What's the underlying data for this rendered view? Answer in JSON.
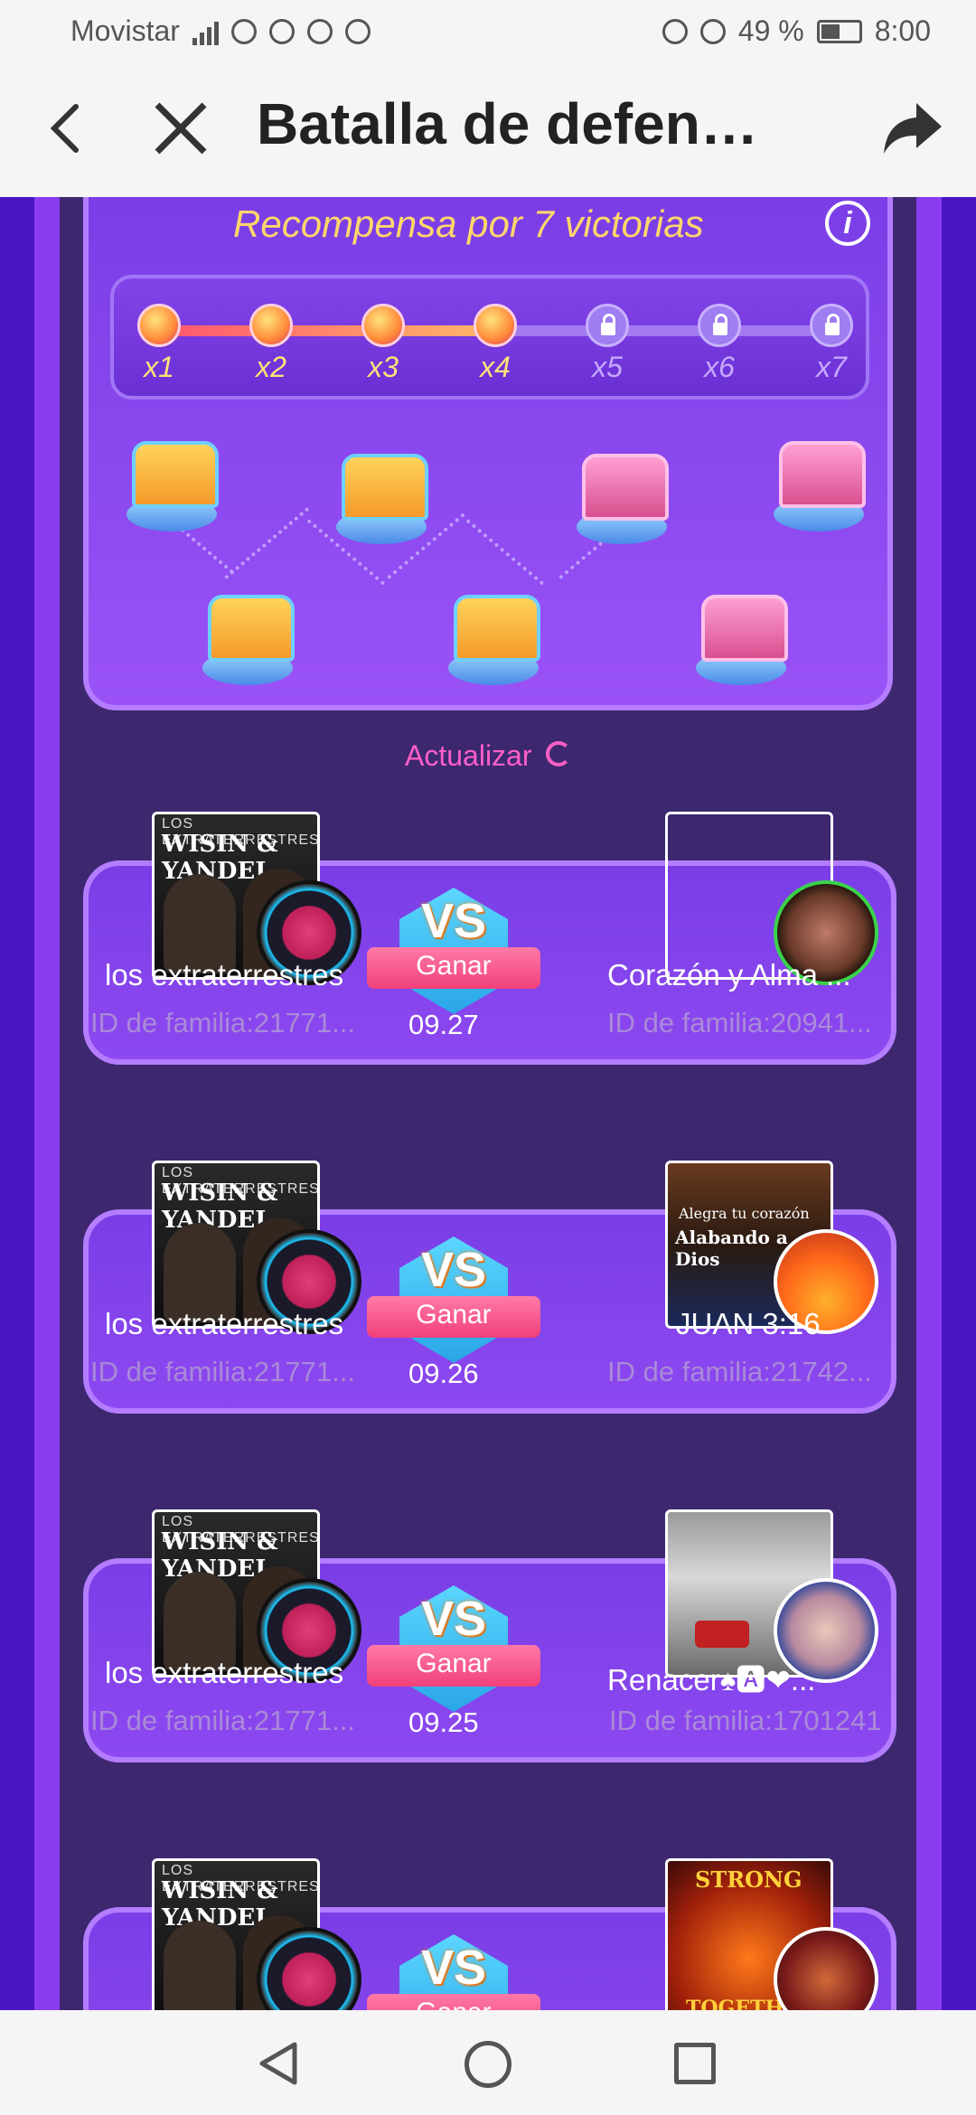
{
  "status_bar": {
    "carrier": "Movistar",
    "battery": "49 %",
    "time": "8:00"
  },
  "header": {
    "title": "Batalla de defen…"
  },
  "rewards": {
    "title": "Recompensa por 7 victorias",
    "info_icon": "i",
    "progress_fraction": 0.5,
    "steps": [
      {
        "label": "x1",
        "state": "done"
      },
      {
        "label": "x2",
        "state": "done"
      },
      {
        "label": "x3",
        "state": "done"
      },
      {
        "label": "x4",
        "state": "done"
      },
      {
        "label": "x5",
        "state": "locked"
      },
      {
        "label": "x6",
        "state": "locked"
      },
      {
        "label": "x7",
        "state": "locked"
      }
    ]
  },
  "update": {
    "label": "Actualizar"
  },
  "battles": [
    {
      "left_name": "los extraterrestres",
      "left_id": "ID de familia:21771...",
      "result": "Ganar",
      "vs": "VS",
      "date": "09.27",
      "right_name": "Corazón y Alma ...",
      "right_id": "ID de familia:20941..."
    },
    {
      "left_name": "los extraterrestres",
      "left_id": "ID de familia:21771...",
      "result": "Ganar",
      "vs": "VS",
      "date": "09.26",
      "right_name": "JUAN 3:16",
      "right_id": "ID de familia:21742..."
    },
    {
      "left_name": "los extraterrestres",
      "left_id": "ID de familia:21771...",
      "result": "Ganar",
      "vs": "VS",
      "date": "09.25",
      "right_name": "Renacer♠🅰❤...",
      "right_id": "ID de familia:1701241"
    },
    {
      "left_name": "",
      "left_id": "",
      "result": "Ganar",
      "vs": "VS",
      "date": "",
      "right_name": "",
      "right_id": ""
    }
  ],
  "album_text": {
    "line1": "LOS EXTRATERRESTRES",
    "line2": "WISIN & YANDEL"
  },
  "right_album_text": {
    "juan": "Alegra tu corazón",
    "juan2": "Alabando a Dios",
    "strong": "STRONG",
    "toget": "TOGETH"
  },
  "colors": {
    "accent_pink": "#ff5fc6",
    "gold": "#ffd66b",
    "panel": "#7a3ee6"
  }
}
